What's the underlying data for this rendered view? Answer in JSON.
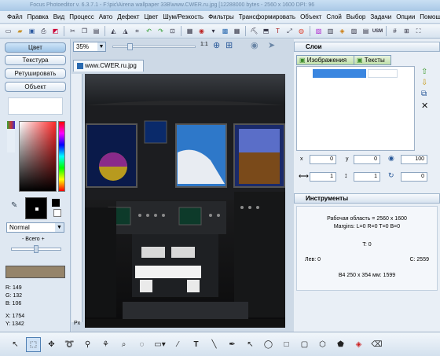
{
  "window": {
    "title": "Focus Photoeditor v. 6.3.7.1 - F:\\pic\\Airena wallpaper 33B\\www.CWER.ru.jpg [12288000 bytes - 2560 x 1600 DPI: 96"
  },
  "menu": [
    "Файл",
    "Правка",
    "Вид",
    "Процесс",
    "Авто",
    "Дефект",
    "Цвет",
    "Шум/Резкость",
    "Фильтры",
    "Трансформировать",
    "Объект",
    "Слой",
    "Выбор",
    "Задачи",
    "Опции",
    "Помощь"
  ],
  "toolbar": {
    "zoom_value": "35%",
    "zoom_options_label": "35%"
  },
  "left_panel": {
    "modes": [
      "Цвет",
      "Текстура",
      "Ретушировать",
      "Объект"
    ],
    "active_mode": "Цвет",
    "blend_mode": "Normal",
    "brush_size_label": "- Всего +",
    "color_readout": {
      "r": "R: 149",
      "g": "G: 132",
      "b": "B: 106",
      "x": "X: 1754",
      "y": "Y: 1342"
    },
    "swatch_color": "#95846a",
    "picker_hue": "#ff2a2a"
  },
  "canvas": {
    "tab_label": "www.CWER.ru.jpg",
    "ruler_unit": "Px"
  },
  "layers_panel": {
    "title": "Слои",
    "tabs": [
      "Изображения",
      "Тексты"
    ],
    "x_label": "x",
    "y_label": "y",
    "x_value": "0",
    "y_value": "0",
    "opacity_value": "100",
    "scale_x_value": "1",
    "scale_y_value": "1",
    "rotate_value": "0"
  },
  "tools_panel": {
    "title": "Инструменты",
    "work_area": "Рабочая область = 2560 x 1600",
    "margins": "Margins: L=0 R=0 T=0 B=0",
    "t_value": "T: 0",
    "left_value": "Лев: 0",
    "right_value": "С: 2559",
    "bottom_value": "B4 250 x 354 мм: 1599"
  },
  "bottom_tools": [
    "arrow-icon",
    "select-rect-icon",
    "move-icon",
    "lasso-icon",
    "magic-wand-icon",
    "clone-icon",
    "brush-icon",
    "freeform-icon",
    "shape-dropdown-icon",
    "eyedropper-icon",
    "text-icon",
    "line-icon",
    "pen-icon",
    "arrow-line-icon",
    "ellipse-icon",
    "rectangle-icon",
    "rounded-rect-icon",
    "hexagon-icon",
    "crop-icon",
    "fill-icon",
    "eraser-icon"
  ],
  "colors": {
    "accent": "#4f7fb3",
    "panel_bg": "#e9eff6",
    "selection": "#3a86e0"
  }
}
